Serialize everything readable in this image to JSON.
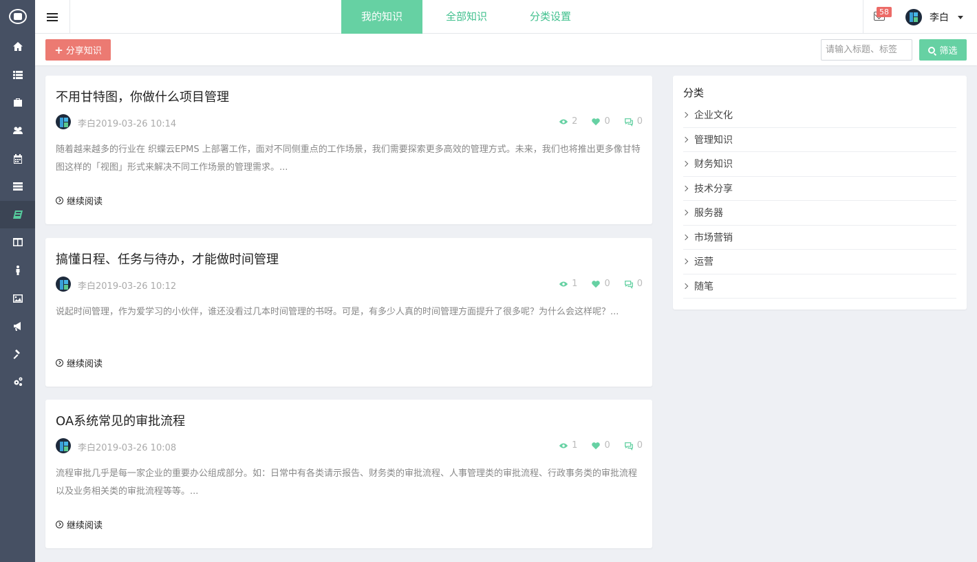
{
  "sidebar": {
    "logo": "app-logo",
    "items": [
      {
        "icon": "home-icon"
      },
      {
        "icon": "list-icon"
      },
      {
        "icon": "briefcase-icon"
      },
      {
        "icon": "users-icon"
      },
      {
        "icon": "calendar-icon"
      },
      {
        "icon": "server-icon"
      },
      {
        "icon": "book-icon",
        "active": true
      },
      {
        "icon": "columns-icon"
      },
      {
        "icon": "person-icon"
      },
      {
        "icon": "image-icon"
      },
      {
        "icon": "megaphone-icon"
      },
      {
        "icon": "gavel-icon"
      },
      {
        "icon": "gears-icon"
      }
    ]
  },
  "header": {
    "tabs": [
      {
        "label": "我的知识",
        "active": true
      },
      {
        "label": "全部知识",
        "active": false
      },
      {
        "label": "分类设置",
        "active": false
      }
    ],
    "mail_count": "58",
    "user_name": "李白"
  },
  "toolbar": {
    "share_label": "分享知识",
    "search_placeholder": "请输入标题、标签",
    "filter_label": "筛选"
  },
  "articles": [
    {
      "title": "不用甘特图，你做什么项目管理",
      "meta": "李白2019-03-26 10:14",
      "views": "2",
      "likes": "0",
      "comments": "0",
      "excerpt": "随着越来越多的行业在 织蝶云EPMS 上部署工作，面对不同侧重点的工作场景，我们需要探索更多高效的管理方式。未来，我们也将推出更多像甘特图这样的「视图」形式来解决不同工作场景的管理需求。...",
      "read_more": "继续阅读"
    },
    {
      "title": "搞懂日程、任务与待办，才能做时间管理",
      "meta": "李白2019-03-26 10:12",
      "views": "1",
      "likes": "0",
      "comments": "0",
      "excerpt": "说起时间管理，作为爱学习的小伙伴，谁还没看过几本时间管理的书呀。可是，有多少人真的时间管理方面提升了很多呢？为什么会这样呢？...",
      "read_more": "继续阅读"
    },
    {
      "title": "OA系统常见的审批流程",
      "meta": "李白2019-03-26 10:08",
      "views": "1",
      "likes": "0",
      "comments": "0",
      "excerpt": "流程审批几乎是每一家企业的重要办公组成部分。如：日常中有各类请示报告、财务类的审批流程、人事管理类的审批流程、行政事务类的审批流程以及业务相关类的审批流程等等。...",
      "read_more": "继续阅读"
    }
  ],
  "categories": {
    "title": "分类",
    "items": [
      "企业文化",
      "管理知识",
      "财务知识",
      "技术分享",
      "服务器",
      "市场营销",
      "运营",
      "随笔"
    ]
  },
  "colors": {
    "accent": "#66d1a3",
    "share": "#ec7a72",
    "sidebar": "#465063"
  }
}
